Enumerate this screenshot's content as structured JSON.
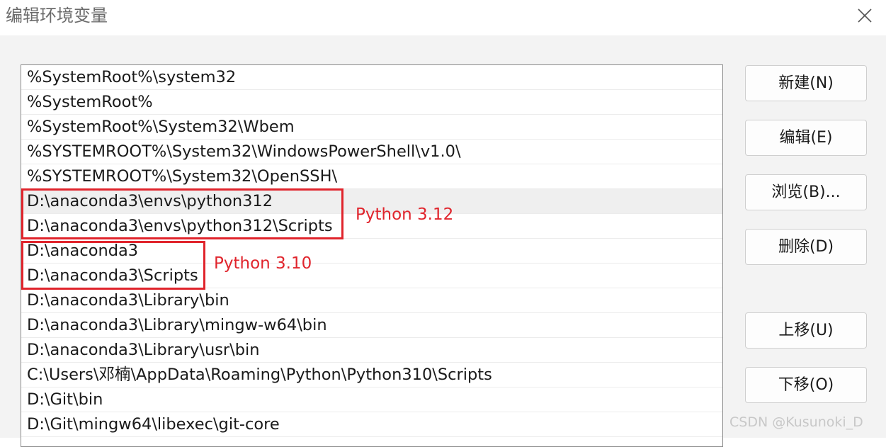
{
  "window": {
    "title": "编辑环境变量",
    "close_icon": "close-icon"
  },
  "paths": [
    "%SystemRoot%\\system32",
    "%SystemRoot%",
    "%SystemRoot%\\System32\\Wbem",
    "%SYSTEMROOT%\\System32\\WindowsPowerShell\\v1.0\\",
    "%SYSTEMROOT%\\System32\\OpenSSH\\",
    "D:\\anaconda3\\envs\\python312",
    "D:\\anaconda3\\envs\\python312\\Scripts",
    "D:\\anaconda3",
    "D:\\anaconda3\\Scripts",
    "D:\\anaconda3\\Library\\bin",
    "D:\\anaconda3\\Library\\mingw-w64\\bin",
    "D:\\anaconda3\\Library\\usr\\bin",
    "C:\\Users\\邓楠\\AppData\\Roaming\\Python\\Python310\\Scripts",
    "D:\\Git\\bin",
    "D:\\Git\\mingw64\\libexec\\git-core"
  ],
  "hovered_row_index": 5,
  "buttons": {
    "new": "新建(N)",
    "edit": "编辑(E)",
    "browse": "浏览(B)...",
    "delete": "删除(D)",
    "move_up": "上移(U)",
    "move_down": "下移(O)"
  },
  "annotations": {
    "python312": "Python 3.12",
    "python310": "Python 3.10",
    "color": "#e0242c"
  },
  "watermark": "CSDN @Kusunoki_D"
}
